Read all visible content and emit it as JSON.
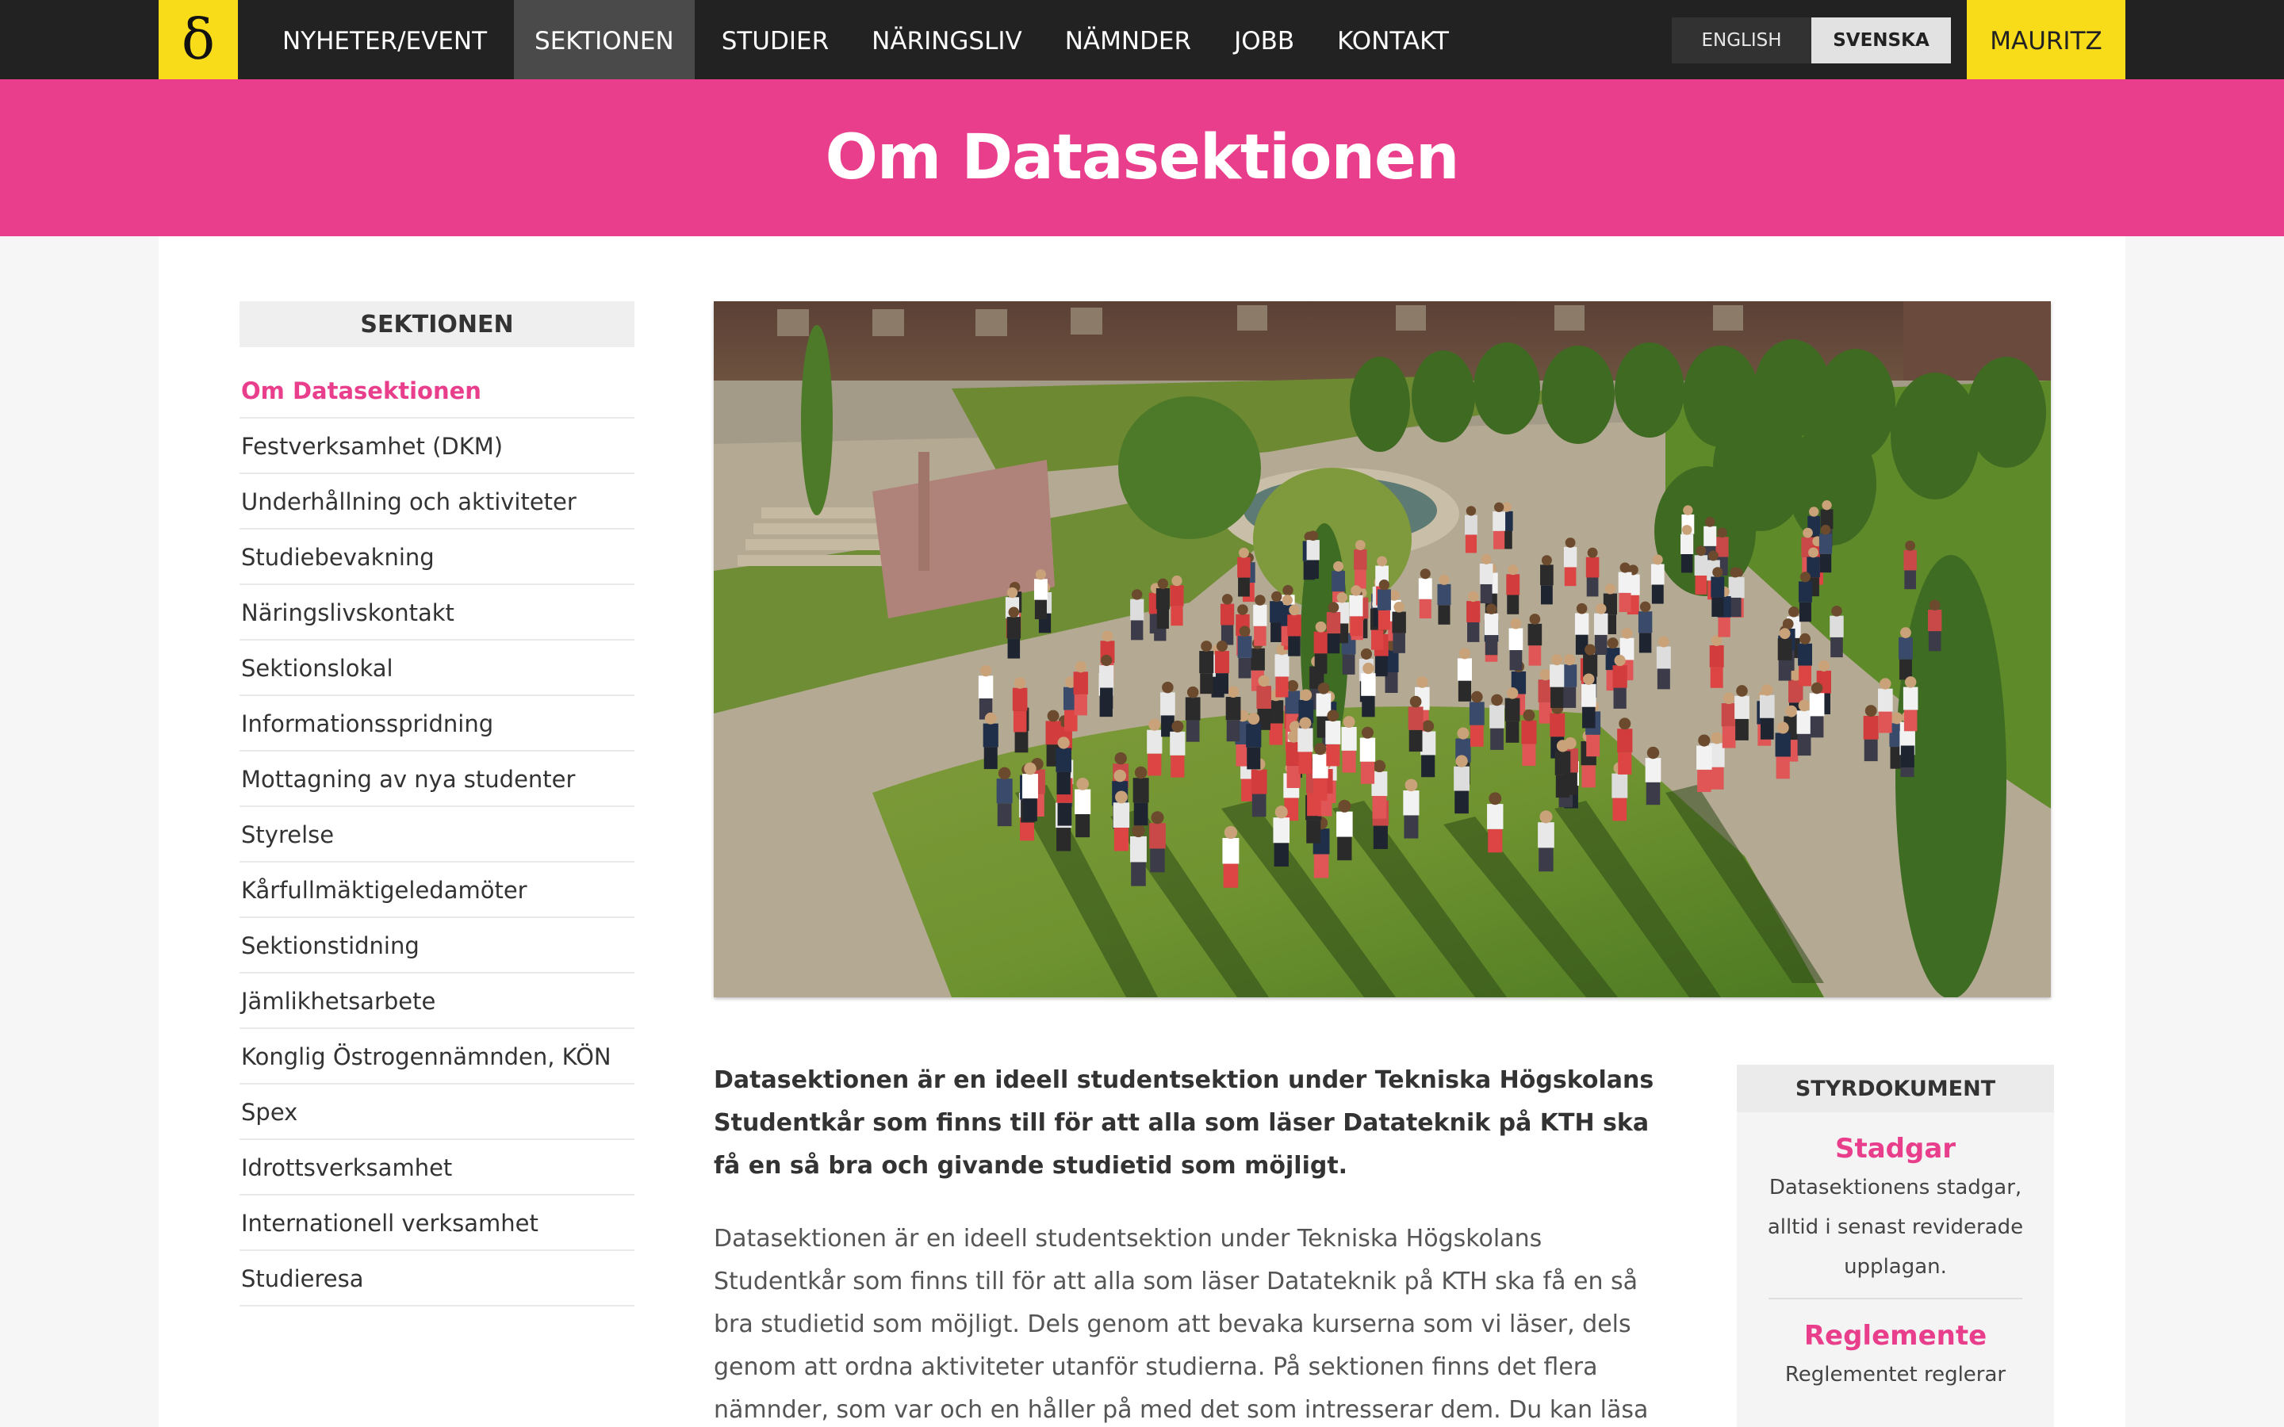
{
  "nav": {
    "logo_glyph": "δ",
    "items": [
      {
        "label": "NYHETER/EVENT"
      },
      {
        "label": "SEKTIONEN"
      },
      {
        "label": "STUDIER"
      },
      {
        "label": "NÄRINGSLIV"
      },
      {
        "label": "NÄMNDER"
      },
      {
        "label": "JOBB"
      },
      {
        "label": "KONTAKT"
      }
    ],
    "active_index": 1,
    "lang_english": "ENGLISH",
    "lang_svenska": "SVENSKA",
    "mauritz": "MAURITZ"
  },
  "header": {
    "title": "Om Datasektionen"
  },
  "sidebar": {
    "title": "SEKTIONEN",
    "items": [
      {
        "label": "Om Datasektionen"
      },
      {
        "label": "Festverksamhet (DKM)"
      },
      {
        "label": "Underhållning och aktiviteter"
      },
      {
        "label": "Studiebevakning"
      },
      {
        "label": "Näringslivskontakt"
      },
      {
        "label": "Sektionslokal"
      },
      {
        "label": "Informationsspridning"
      },
      {
        "label": "Mottagning av nya studenter"
      },
      {
        "label": "Styrelse"
      },
      {
        "label": "Kårfullmäktigeledamöter"
      },
      {
        "label": "Sektionstidning"
      },
      {
        "label": "Jämlikhetsarbete"
      },
      {
        "label": "Konglig Östrogennämnden, KÖN"
      },
      {
        "label": "Spex"
      },
      {
        "label": "Idrottsverksamhet"
      },
      {
        "label": "Internationell verksamhet"
      },
      {
        "label": "Studieresa"
      }
    ],
    "active_index": 0
  },
  "main": {
    "lead": "Datasektionen är en ideell studentsektion under Tekniska Högskolans Studentkår som finns till för att alla som läser Datateknik på KTH ska få en så bra och givande studietid som möjligt.",
    "body": "Datasektionen är en ideell studentsektion under Tekniska Högskolans Studentkår som finns till för att alla som läser Datateknik på KTH ska få en så bra studietid som möjligt. Dels genom att bevaka kurserna som vi läser, dels genom att ordna aktiviteter utanför studierna. På sektionen finns det flera nämnder, som var och en håller på med det som intresserar dem. Du kan läsa mer om olika saker de gör här nedan."
  },
  "widget": {
    "title": "STYRDOKUMENT",
    "docs": [
      {
        "title": "Stadgar",
        "desc": "Datasektionens stadgar, alltid i senast reviderade upplagan."
      },
      {
        "title": "Reglemente",
        "desc": "Reglementet reglerar"
      }
    ]
  },
  "colors": {
    "accent": "#e83e8c",
    "yellow": "#f8dc1a",
    "topbar": "#222222"
  }
}
